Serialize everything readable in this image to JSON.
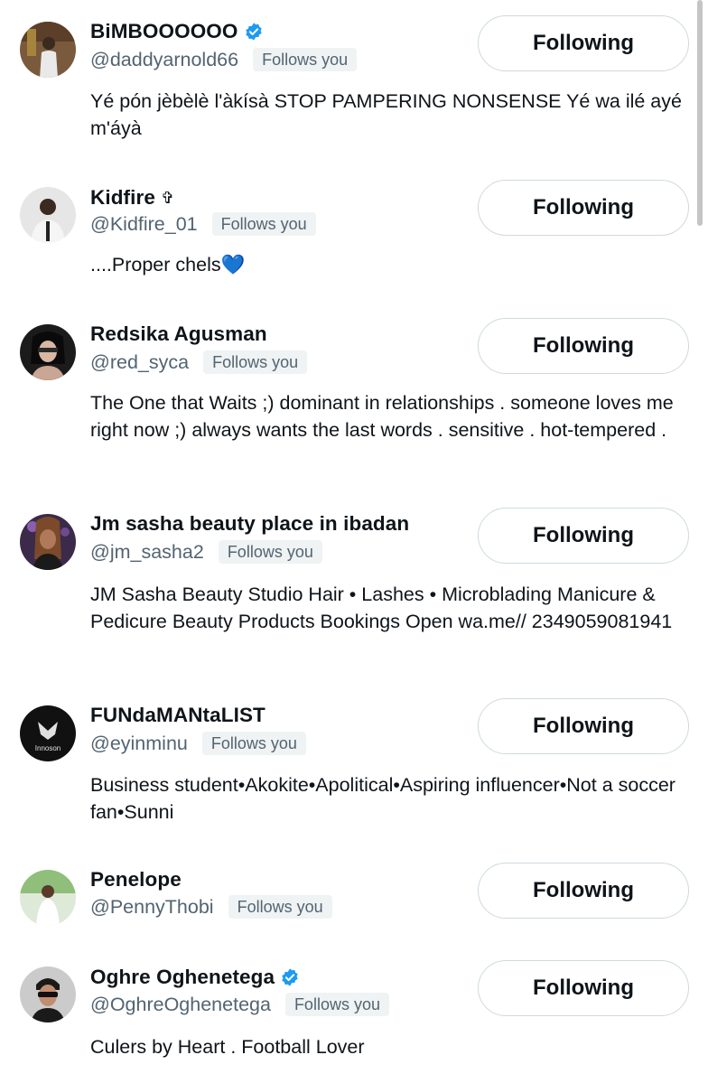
{
  "users": [
    {
      "name": "BiMBOOOOOO",
      "verified": true,
      "name_icon": "",
      "handle": "@daddyarnold66",
      "follows_label": "Follows you",
      "button_label": "Following",
      "bio": "Yé pón jèbèlè l'àkísà STOP PAMPERING NONSENSE Yé wa ilé ayé m'áyà",
      "avatar_color": "#7a5a3c"
    },
    {
      "name": "Kidfire",
      "verified": false,
      "name_icon": "✞",
      "handle": "@Kidfire_01",
      "follows_label": "Follows you",
      "button_label": "Following",
      "bio": "....Proper chels💙",
      "avatar_color": "#d9d9d9"
    },
    {
      "name": "Redsika Agusman",
      "verified": false,
      "name_icon": "",
      "handle": "@red_syca",
      "follows_label": "Follows you",
      "button_label": "Following",
      "bio": "The One that Waits ;) dominant in relationships . someone loves me right now ;) always wants the last words . sensitive . hot-tempered .",
      "avatar_color": "#1b1b1b"
    },
    {
      "name": "Jm sasha beauty place in ibadan",
      "verified": false,
      "name_icon": "",
      "handle": "@jm_sasha2",
      "follows_label": "Follows you",
      "button_label": "Following",
      "bio": "JM Sasha Beauty Studio Hair • Lashes • Microblading Manicure & Pedicure Beauty Products Bookings Open wa.me// 2349059081941",
      "avatar_color": "#3b2a4a"
    },
    {
      "name": "FUNdaMANtaLIST",
      "verified": false,
      "name_icon": "",
      "handle": "@eyinminu",
      "follows_label": "Follows you",
      "button_label": "Following",
      "bio": "Business student•Akokite•Apolitical•Aspiring influencer•Not a soccer fan•Sunni",
      "avatar_color": "#111111",
      "avatar_text": "Innoson"
    },
    {
      "name": "Penelope",
      "verified": false,
      "name_icon": "",
      "handle": "@PennyThobi",
      "follows_label": "Follows you",
      "button_label": "Following",
      "bio": "",
      "avatar_color": "#8fbf7a"
    },
    {
      "name": "Oghre Oghenetega",
      "verified": true,
      "name_icon": "",
      "handle": "@OghreOghenetega",
      "follows_label": "Follows you",
      "button_label": "Following",
      "bio": "Culers by Heart . Football Lover",
      "avatar_color": "#2a2a2a"
    }
  ],
  "colors": {
    "verified_blue": "#1d9bf0",
    "text_primary": "#0f1419",
    "text_secondary": "#536471",
    "badge_bg": "#eff3f4",
    "button_border": "#cfd9de"
  }
}
